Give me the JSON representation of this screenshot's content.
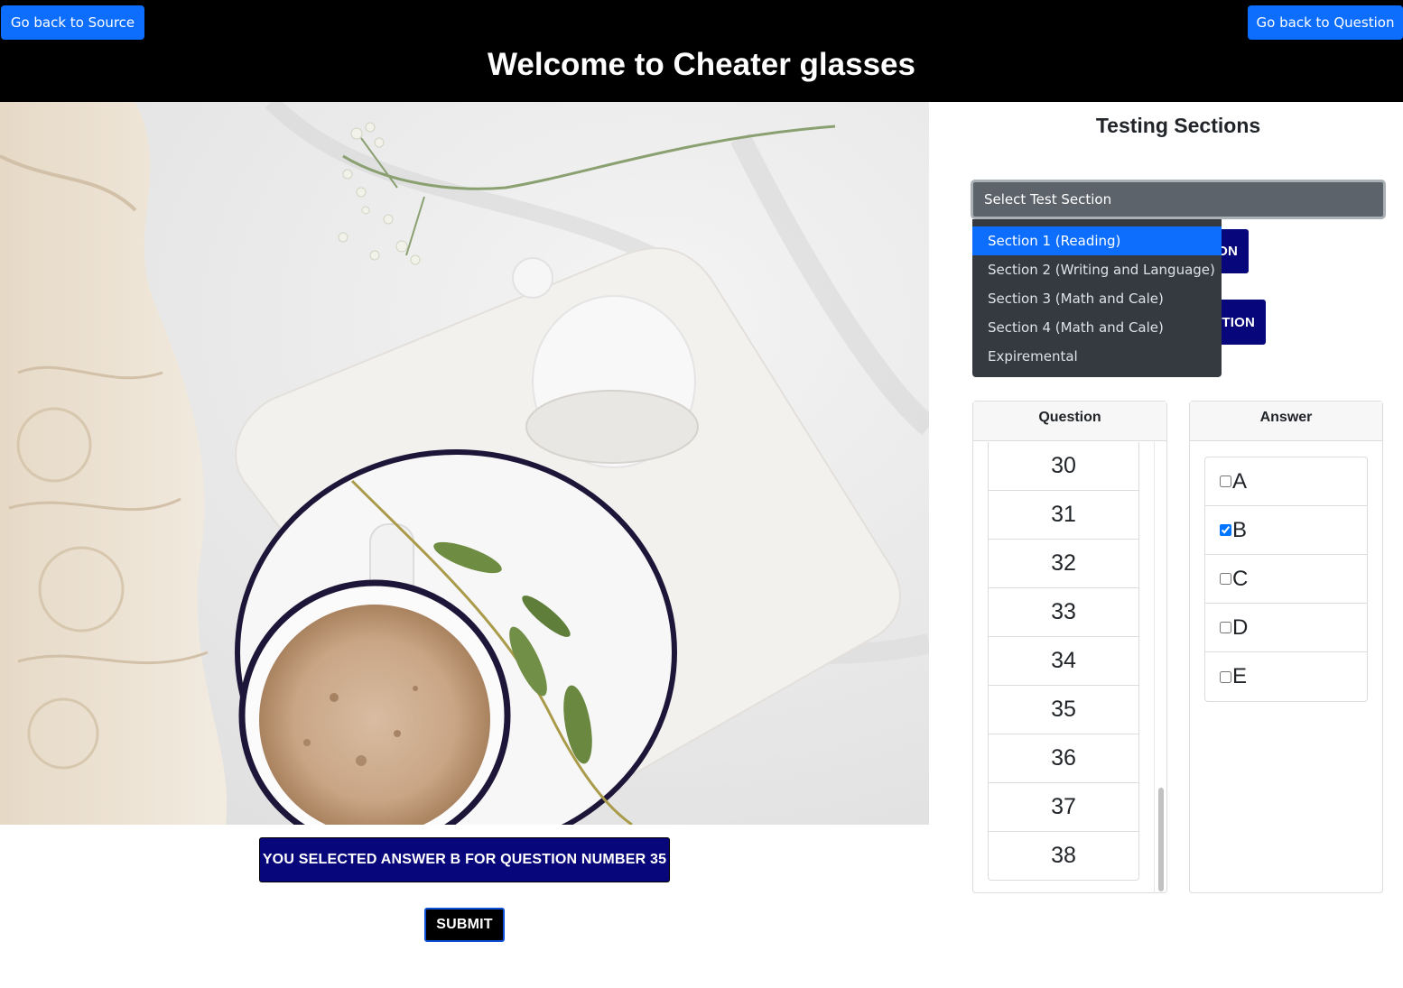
{
  "header": {
    "back_source_label": "Go back to Source",
    "back_question_label": "Go back to Question",
    "title": "Welcome to Cheater glasses"
  },
  "main": {
    "selected_message": "YOU SELECTED ANSWER B FOR QUESTION NUMBER 35",
    "submit_label": "SUBMIT"
  },
  "sections": {
    "title": "Testing Sections",
    "select_placeholder": "Select Test Section",
    "options": [
      {
        "label": "Section 1 (Reading)",
        "highlighted": true
      },
      {
        "label": "Section 2 (Writing and Language)",
        "highlighted": false
      },
      {
        "label": "Section 3 (Math and Cale)",
        "highlighted": false
      },
      {
        "label": "Section 4 (Math and Cale)",
        "highlighted": false
      },
      {
        "label": "Expiremental",
        "highlighted": false
      }
    ],
    "hidden_button_1_label": "ON",
    "hidden_button_2_label": "TION"
  },
  "questions": {
    "header": "Question",
    "items": [
      "30",
      "31",
      "32",
      "33",
      "34",
      "35",
      "36",
      "37",
      "38"
    ]
  },
  "answers": {
    "header": "Answer",
    "items": [
      {
        "label": "A",
        "checked": false
      },
      {
        "label": "B",
        "checked": true
      },
      {
        "label": "C",
        "checked": false
      },
      {
        "label": "D",
        "checked": false
      },
      {
        "label": "E",
        "checked": false
      }
    ]
  },
  "colors": {
    "header_bg": "#000000",
    "primary_blue": "#0d6efd",
    "navy_button": "#07067a",
    "dropdown_bg": "#343a40",
    "select_bg": "#5c636a"
  }
}
